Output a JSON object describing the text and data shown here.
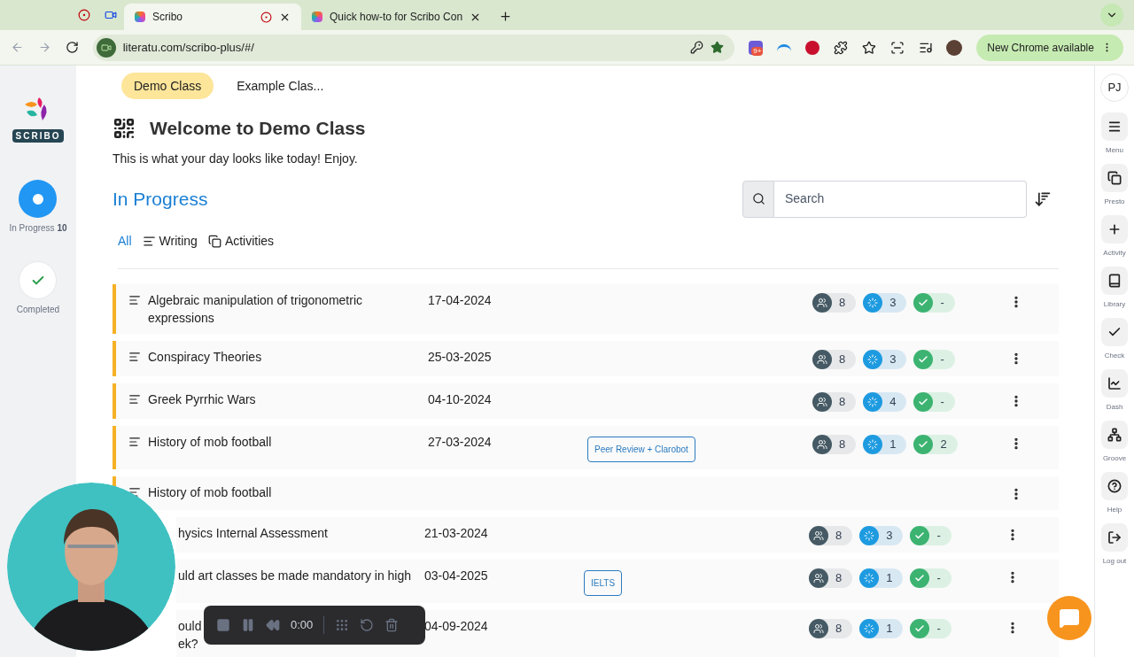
{
  "browser": {
    "tabs": [
      {
        "title": "Scribo",
        "selected": true
      },
      {
        "title": "Quick how-to for Scribo Con",
        "selected": false
      }
    ],
    "url": "literatu.com/scribo-plus/#/",
    "extension_badge": "9+",
    "update_button": "New Chrome available"
  },
  "logo": {
    "text": "SCRIBO"
  },
  "left_nav": [
    {
      "label": "In Progress",
      "count": "10",
      "kind": "progress",
      "selected": true
    },
    {
      "label": "Completed",
      "kind": "completed",
      "selected": false
    }
  ],
  "class_tabs": [
    {
      "label": "Demo Class",
      "selected": true
    },
    {
      "label": "Example Clas...",
      "selected": false
    }
  ],
  "heading": "Welcome to Demo Class",
  "subtitle": "This is what your day looks like today! Enjoy.",
  "section_title": "In Progress",
  "search": {
    "placeholder": "Search"
  },
  "filters": [
    {
      "label": "All",
      "kind": "all",
      "selected": true
    },
    {
      "label": "Writing",
      "kind": "writing",
      "selected": false
    },
    {
      "label": "Activities",
      "kind": "activities",
      "selected": false
    }
  ],
  "rows": [
    {
      "title": "Algebraic manipulation of trigonometric expressions",
      "clipped": false,
      "date": "17-04-2024",
      "stats": {
        "students": "8",
        "in_progress": "3",
        "completed": "-"
      }
    },
    {
      "title": "Conspiracy Theories",
      "clipped": false,
      "date": "25-03-2025",
      "stats": {
        "students": "8",
        "in_progress": "3",
        "completed": "-"
      }
    },
    {
      "title": "Greek Pyrrhic Wars",
      "clipped": false,
      "date": "04-10-2024",
      "stats": {
        "students": "8",
        "in_progress": "4",
        "completed": "-"
      }
    },
    {
      "title": "History of mob football",
      "clipped": false,
      "date": "27-03-2024",
      "tag": "Peer Review + Clarobot",
      "stats": {
        "students": "8",
        "in_progress": "1",
        "completed": "2"
      }
    },
    {
      "title": "History of mob football",
      "clipped": false
    },
    {
      "title": "hysics Internal Assessment",
      "clipped": true,
      "date": "21-03-2024",
      "stats": {
        "students": "8",
        "in_progress": "3",
        "completed": "-"
      }
    },
    {
      "title": "uld art classes be made mandatory in high",
      "clipped": true,
      "date": "03-04-2025",
      "tag": "IELTS",
      "stats": {
        "students": "8",
        "in_progress": "1",
        "completed": "-"
      }
    },
    {
      "title": "ould\nek?",
      "clipped": true,
      "date": "04-09-2024",
      "stats": {
        "students": "8",
        "in_progress": "1",
        "completed": "-"
      }
    }
  ],
  "right_nav": {
    "avatar": "PJ",
    "items": [
      {
        "label": "Menu",
        "kind": "menu"
      },
      {
        "label": "Presto",
        "kind": "presto"
      },
      {
        "label": "Activity",
        "kind": "activity"
      },
      {
        "label": "Library",
        "kind": "library"
      },
      {
        "label": "Check",
        "kind": "check"
      },
      {
        "label": "Dash",
        "kind": "dash"
      },
      {
        "label": "Groove",
        "kind": "groove"
      },
      {
        "label": "Help",
        "kind": "help"
      },
      {
        "label": "Log out",
        "kind": "logout"
      }
    ]
  },
  "recorder": {
    "time": "0:00"
  }
}
